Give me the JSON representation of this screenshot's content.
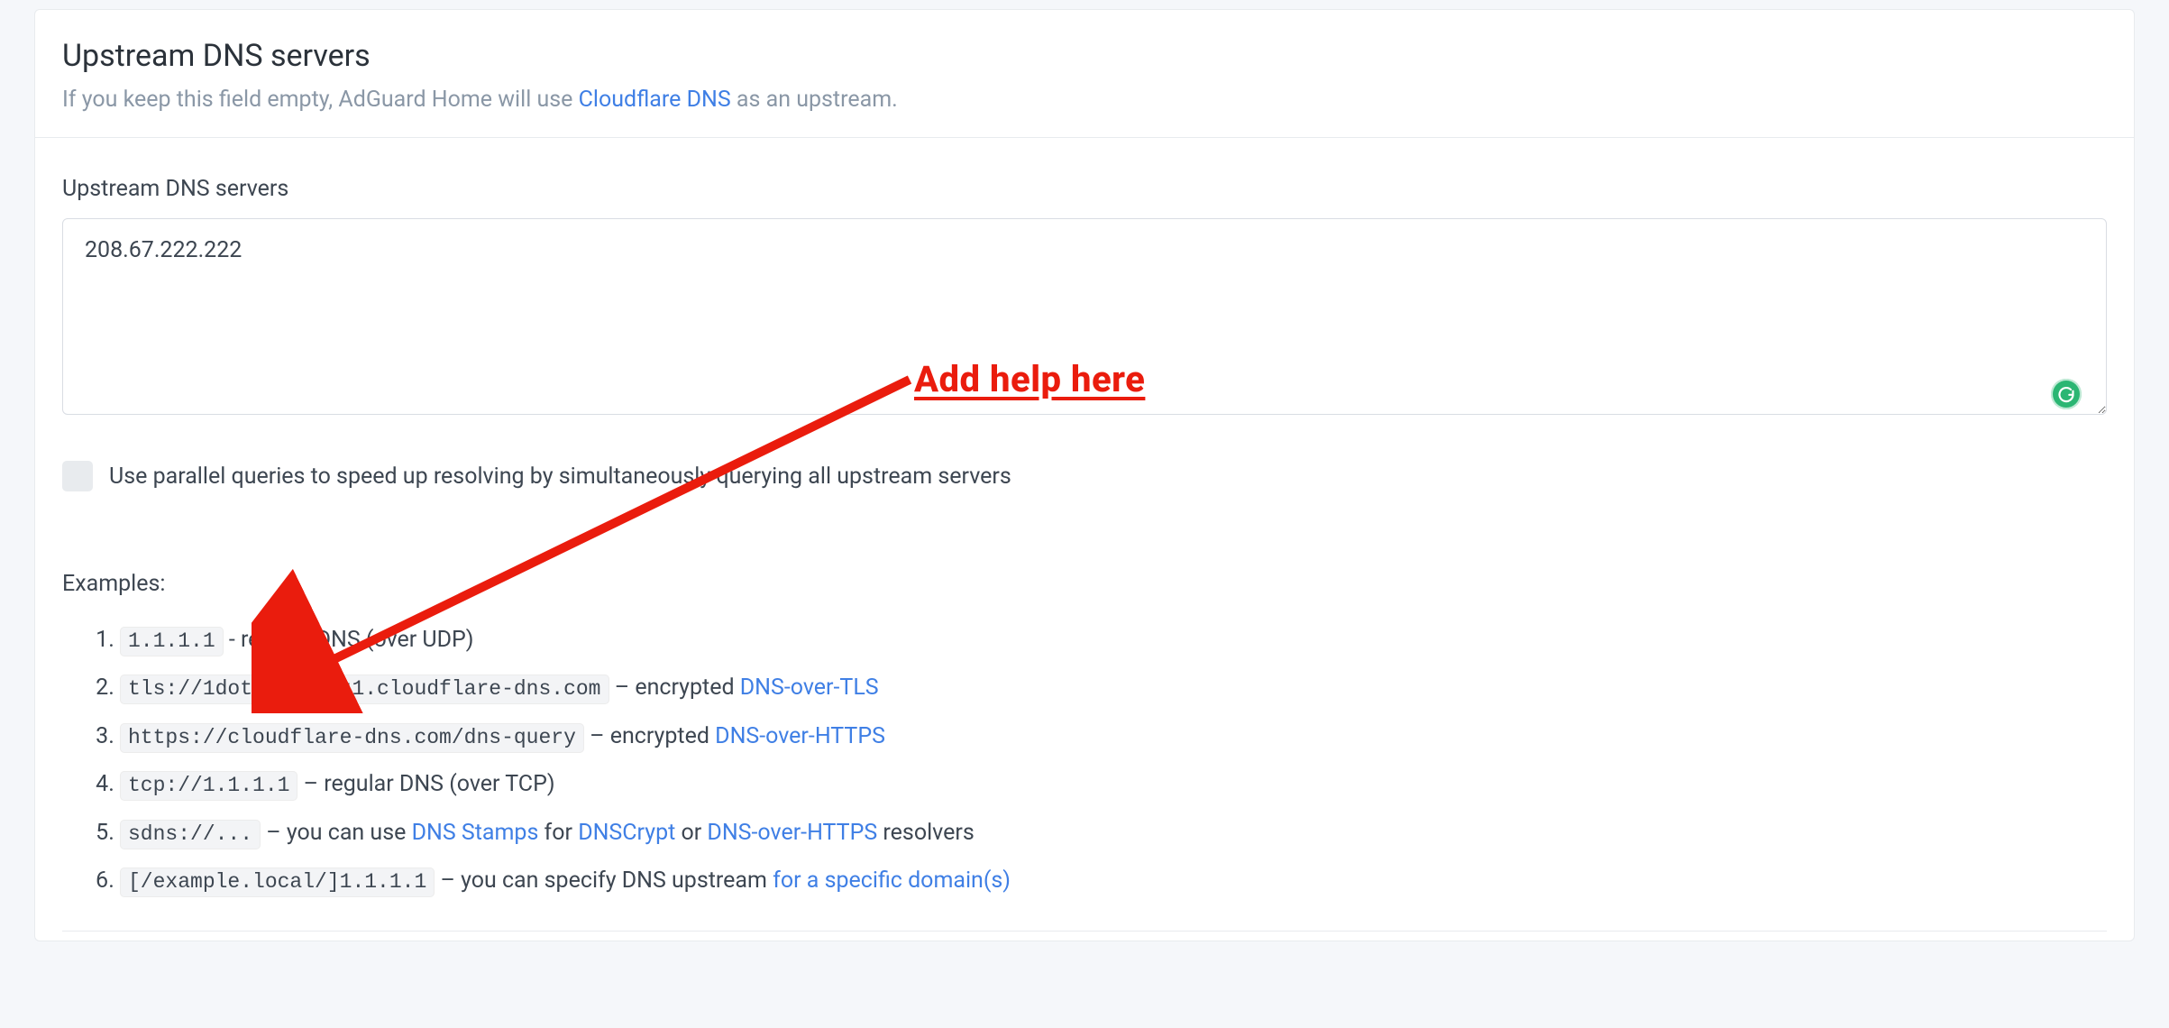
{
  "header": {
    "title": "Upstream DNS servers",
    "subtitle_prefix": "If you keep this field empty, AdGuard Home will use ",
    "subtitle_link": "Cloudflare DNS",
    "subtitle_suffix": " as an upstream."
  },
  "form": {
    "label": "Upstream DNS servers",
    "value": "208.67.222.222",
    "checkbox_label": "Use parallel queries to speed up resolving by simultaneously querying all upstream servers"
  },
  "annotation": {
    "text": "Add help here"
  },
  "examples": {
    "label": "Examples:",
    "items": [
      {
        "code": "1.1.1.1",
        "sep": " - ",
        "text": "regular DNS (over UDP)",
        "links": []
      },
      {
        "code": "tls://1dot1dot1dot1.cloudflare-dns.com",
        "sep": " – ",
        "text": "encrypted ",
        "links": [
          {
            "label": "DNS-over-TLS"
          }
        ]
      },
      {
        "code": "https://cloudflare-dns.com/dns-query",
        "sep": " – ",
        "text": "encrypted ",
        "links": [
          {
            "label": "DNS-over-HTTPS"
          }
        ]
      },
      {
        "code": "tcp://1.1.1.1",
        "sep": " – ",
        "text": "regular DNS (over TCP)",
        "links": []
      },
      {
        "code": "sdns://...",
        "sep": " – ",
        "text": "you can use ",
        "links": [
          {
            "label": "DNS Stamps"
          },
          {
            "mid": " for "
          },
          {
            "label": "DNSCrypt"
          },
          {
            "mid": " or "
          },
          {
            "label": "DNS-over-HTTPS"
          }
        ],
        "tail": " resolvers"
      },
      {
        "code": "[/example.local/]1.1.1.1",
        "sep": " – ",
        "text": "you can specify DNS upstream ",
        "links": [
          {
            "label": "for a specific domain(s)"
          }
        ]
      }
    ]
  }
}
